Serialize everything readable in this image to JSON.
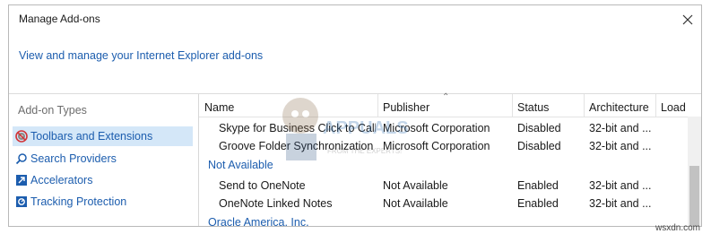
{
  "window": {
    "title": "Manage Add-ons"
  },
  "header": {
    "subtitle": "View and manage your Internet Explorer add-ons"
  },
  "sidebar": {
    "heading": "Add-on Types",
    "items": [
      {
        "label": "Toolbars and Extensions",
        "icon": "gear-blocked-icon",
        "selected": true
      },
      {
        "label": "Search Providers",
        "icon": "search-icon",
        "selected": false
      },
      {
        "label": "Accelerators",
        "icon": "accelerator-icon",
        "selected": false
      },
      {
        "label": "Tracking Protection",
        "icon": "shield-icon",
        "selected": false
      }
    ]
  },
  "table": {
    "columns": [
      "Name",
      "Publisher",
      "Status",
      "Architecture",
      "Load"
    ],
    "rows": [
      {
        "name": "Skype for Business Click to Call",
        "publisher": "Microsoft Corporation",
        "status": "Disabled",
        "architecture": "32-bit and ..."
      },
      {
        "name": "Groove Folder Synchronization",
        "publisher": "Microsoft Corporation",
        "status": "Disabled",
        "architecture": "32-bit and ..."
      }
    ],
    "group_not_available": "Not Available",
    "rows2": [
      {
        "name": "Send to OneNote",
        "publisher": "Not Available",
        "status": "Enabled",
        "architecture": "32-bit and ..."
      },
      {
        "name": "OneNote Linked Notes",
        "publisher": "Not Available",
        "status": "Enabled",
        "architecture": "32-bit and ..."
      }
    ],
    "group_oracle": "Oracle America, Inc."
  },
  "watermark": {
    "brand": "APPUALS",
    "tagline": "FROM THE EXPERTS!"
  },
  "credit": "wsxdn.com",
  "colors": {
    "link": "#1c5dae",
    "selection": "#d4e7f8"
  }
}
